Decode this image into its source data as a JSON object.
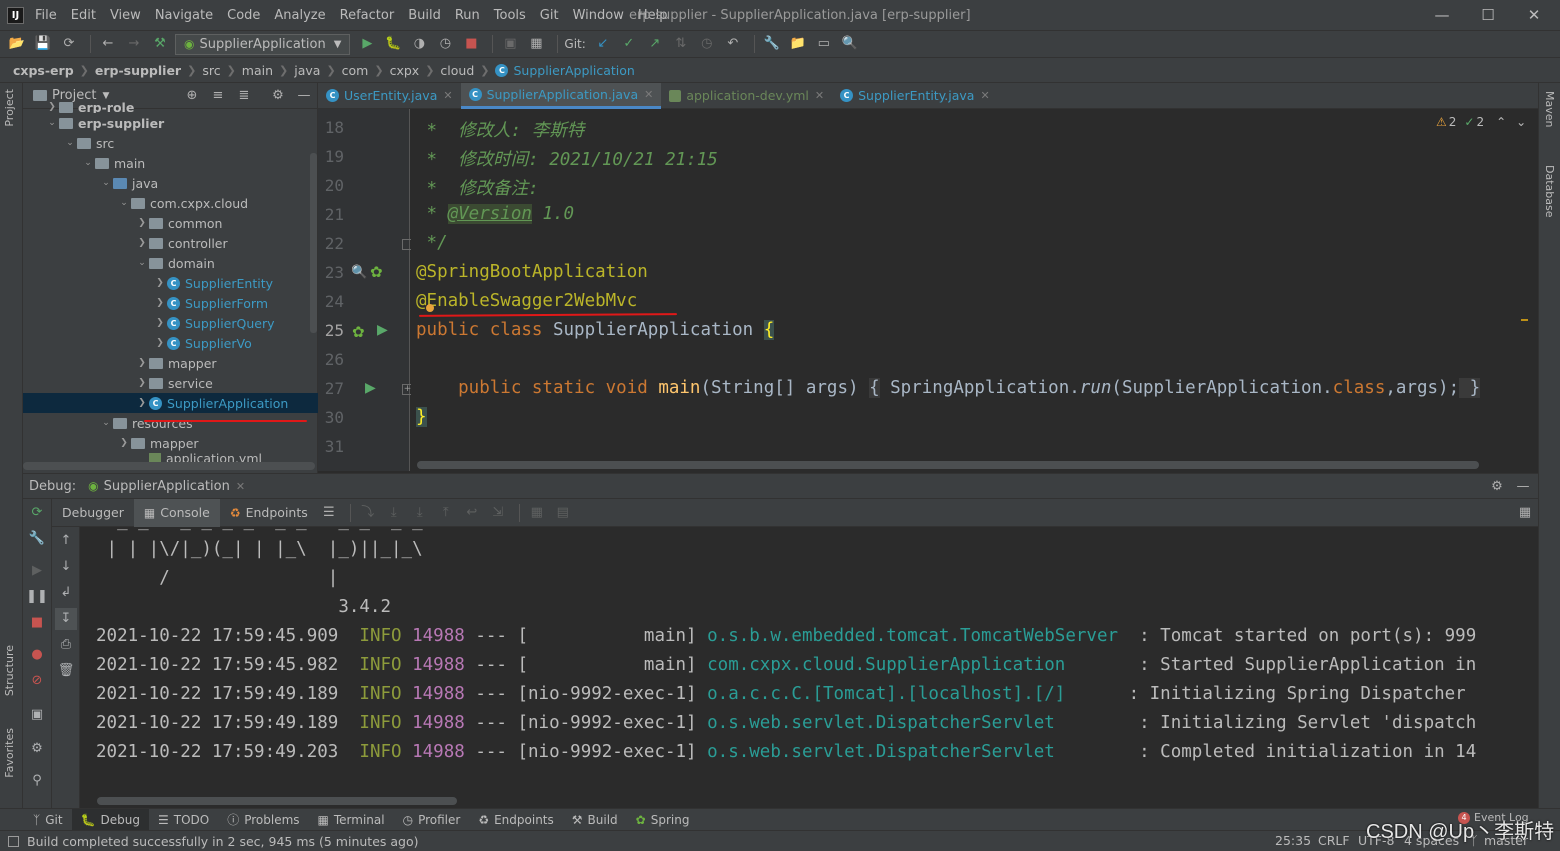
{
  "colors": {
    "accent": "#4a88c7",
    "annotation_underline": "#e01818"
  },
  "menubar": {
    "logo": "IJ",
    "items": [
      "File",
      "Edit",
      "View",
      "Navigate",
      "Code",
      "Analyze",
      "Refactor",
      "Build",
      "Run",
      "Tools",
      "Git",
      "Window",
      "Help"
    ],
    "window_title": "erp-supplier - SupplierApplication.java [erp-supplier]",
    "minimize": "—",
    "maximize": "☐",
    "close": "✕"
  },
  "toolbar": {
    "run_config": "SupplierApplication",
    "git_label": "Git:"
  },
  "breadcrumb": [
    "cxps-erp",
    "erp-supplier",
    "src",
    "main",
    "java",
    "com",
    "cxpx",
    "cloud",
    "SupplierApplication"
  ],
  "left_stripe": {
    "project": "Project",
    "structure": "Structure",
    "favorites": "Favorites"
  },
  "right_stripe": {
    "maven": "Maven",
    "database": "Database"
  },
  "project_panel": {
    "title": "Project",
    "tree": [
      {
        "label": "erp-role",
        "kind": "module"
      },
      {
        "label": "erp-supplier",
        "kind": "module"
      },
      {
        "label": "src",
        "kind": "folder"
      },
      {
        "label": "main",
        "kind": "folder"
      },
      {
        "label": "java",
        "kind": "folder-blue"
      },
      {
        "label": "com.cxpx.cloud",
        "kind": "package"
      },
      {
        "label": "common",
        "kind": "package"
      },
      {
        "label": "controller",
        "kind": "package"
      },
      {
        "label": "domain",
        "kind": "package"
      },
      {
        "label": "SupplierEntity",
        "kind": "class"
      },
      {
        "label": "SupplierForm",
        "kind": "class"
      },
      {
        "label": "SupplierQuery",
        "kind": "class"
      },
      {
        "label": "SupplierVo",
        "kind": "class"
      },
      {
        "label": "mapper",
        "kind": "package"
      },
      {
        "label": "service",
        "kind": "package"
      },
      {
        "label": "SupplierApplication",
        "kind": "class"
      },
      {
        "label": "resources",
        "kind": "folder"
      },
      {
        "label": "mapper",
        "kind": "folder"
      },
      {
        "label": "application.yml",
        "kind": "file"
      }
    ]
  },
  "editor_tabs": [
    {
      "label": "UserEntity.java"
    },
    {
      "label": "SupplierApplication.java"
    },
    {
      "label": "application-dev.yml"
    },
    {
      "label": "SupplierEntity.java"
    }
  ],
  "inspections": {
    "warnings": "2",
    "ok": "2"
  },
  "code": {
    "line_numbers": [
      "18",
      "19",
      "20",
      "21",
      "22",
      "23",
      "24",
      "25",
      "26",
      "27",
      "30",
      "31"
    ],
    "l18": " *  修改人: 李斯特",
    "l19": " *  修改时间: 2021/10/21 21:15",
    "l20": " *  修改备注:",
    "l21_prefix": " * ",
    "l21_tag": "@Version",
    "l21_suffix": " 1.0",
    "l22": " */",
    "l23": "@SpringBootApplication",
    "l24": "@EnableSwagger2WebMvc",
    "l25_kw": "public class ",
    "l25_name": "SupplierApplication ",
    "l25_brace": "{",
    "l27_kw": "    public static void ",
    "l27_fn": "main",
    "l27_rest1": "(String[] args) ",
    "l27_b1": "{",
    "l27_rest2": " SpringApplication.",
    "l27_run": "run",
    "l27_rest3": "(SupplierApplication.",
    "l27_class": "class",
    "l27_rest4": ",args);",
    "l27_b2": " }",
    "l30": "}"
  },
  "debug": {
    "label": "Debug:",
    "session": "SupplierApplication",
    "subtabs": [
      "Debugger",
      "Console",
      "Endpoints"
    ]
  },
  "console": {
    "banner1": " | | |\\/|_)(_| | |_\\  |_)||_|_\\",
    "banner2": "      /               |",
    "version": "                       3.4.2",
    "lines": [
      {
        "ts": "2021-10-22 17:59:45.909",
        "lvl": "INFO",
        "pid": "14988",
        "sep": " --- [           main] ",
        "logger": "o.s.b.w.embedded.tomcat.TomcatWebServer ",
        "msg": " : Tomcat started on port(s): 999"
      },
      {
        "ts": "2021-10-22 17:59:45.982",
        "lvl": "INFO",
        "pid": "14988",
        "sep": " --- [           main] ",
        "logger": "com.cxpx.cloud.SupplierApplication      ",
        "msg": " : Started SupplierApplication in"
      },
      {
        "ts": "2021-10-22 17:59:49.189",
        "lvl": "INFO",
        "pid": "14988",
        "sep": " --- [nio-9992-exec-1] ",
        "logger": "o.a.c.c.C.[Tomcat].[localhost].[/]     ",
        "msg": " : Initializing Spring Dispatcher"
      },
      {
        "ts": "2021-10-22 17:59:49.189",
        "lvl": "INFO",
        "pid": "14988",
        "sep": " --- [nio-9992-exec-1] ",
        "logger": "o.s.web.servlet.DispatcherServlet       ",
        "msg": " : Initializing Servlet 'dispatch"
      },
      {
        "ts": "2021-10-22 17:59:49.203",
        "lvl": "INFO",
        "pid": "14988",
        "sep": " --- [nio-9992-exec-1] ",
        "logger": "o.s.web.servlet.DispatcherServlet       ",
        "msg": " : Completed initialization in 14"
      }
    ]
  },
  "bottom_tabs": [
    "Git",
    "Debug",
    "TODO",
    "Problems",
    "Terminal",
    "Profiler",
    "Endpoints",
    "Build",
    "Spring"
  ],
  "event_log": {
    "count": "4",
    "label": "Event Log"
  },
  "status": {
    "message": "Build completed successfully in 2 sec, 945 ms (5 minutes ago)",
    "position": "25:35",
    "line_sep": "CRLF",
    "encoding": "UTF-8",
    "indent": "4 spaces",
    "branch": "master"
  },
  "watermark": "CSDN @Up丶李斯特"
}
